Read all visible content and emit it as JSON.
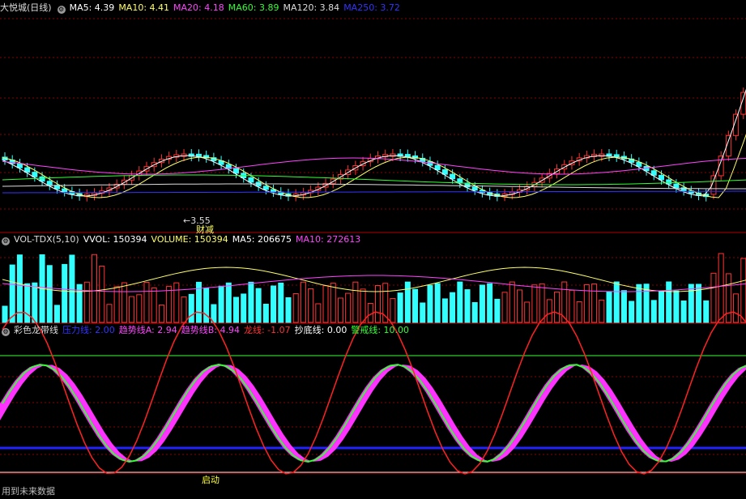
{
  "main_legend": {
    "title": "大悦城(日线)",
    "items": [
      {
        "label": "MA5: 4.39",
        "color": "#ffffff"
      },
      {
        "label": "MA10: 4.41",
        "color": "#ffff66"
      },
      {
        "label": "MA20: 4.18",
        "color": "#ff44ff"
      },
      {
        "label": "MA60: 3.89",
        "color": "#33ff33"
      },
      {
        "label": "MA120: 3.84",
        "color": "#dddddd"
      },
      {
        "label": "MA250: 3.72",
        "color": "#3333ff"
      }
    ]
  },
  "vol_legend": {
    "title": "VOL-TDX(5,10)",
    "items": [
      {
        "label": "VVOL: 150394",
        "color": "#ffffff"
      },
      {
        "label": "VOLUME: 150394",
        "color": "#ffff66"
      },
      {
        "label": "MA5: 206675",
        "color": "#ffffff"
      },
      {
        "label": "MA10: 272613",
        "color": "#ff44ff"
      }
    ]
  },
  "dragon_legend": {
    "title": "彩色龙带线",
    "items": [
      {
        "label": "压力线: 2.00",
        "color": "#3333ff"
      },
      {
        "label": "趋势线A: 2.94",
        "color": "#ff44ff"
      },
      {
        "label": "趋势线B: 4.94",
        "color": "#ff44ff"
      },
      {
        "label": "龙线: -1.07",
        "color": "#ff3333"
      },
      {
        "label": "抄底线: 0.00",
        "color": "#ffffff"
      },
      {
        "label": "警戒线: 10.00",
        "color": "#33ff33"
      }
    ]
  },
  "annotations": {
    "low_price": "3.55",
    "low_arrow": "←",
    "event_label": "财减",
    "start_label": "启动",
    "footer": "用到未来数据"
  },
  "colors": {
    "up": "#ff3333",
    "down": "#33ffff",
    "grid": "#8a0000"
  }
}
